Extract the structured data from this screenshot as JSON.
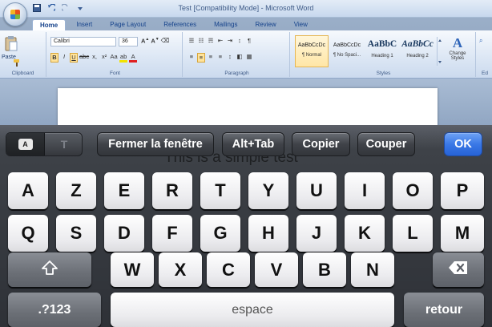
{
  "word": {
    "window_title": "Test [Compatibility Mode] - Microsoft Word",
    "qat_icons": [
      "save-icon",
      "undo-icon",
      "redo-icon",
      "customize-icon"
    ],
    "tabs": [
      "Home",
      "Insert",
      "Page Layout",
      "References",
      "Mailings",
      "Review",
      "View"
    ],
    "groups": {
      "clipboard": {
        "label": "Clipboard",
        "paste": "Paste"
      },
      "font": {
        "label": "Font",
        "name": "Calibri",
        "size": "36"
      },
      "paragraph": {
        "label": "Paragraph"
      },
      "styles": {
        "label": "Styles",
        "items": [
          {
            "sample": "AaBbCcDc",
            "name": "¶ Normal"
          },
          {
            "sample": "AaBbCcDc",
            "name": "¶ No Spaci..."
          },
          {
            "sample": "AaBbC",
            "name": "Heading 1"
          },
          {
            "sample": "AaBbCc",
            "name": "Heading 2"
          }
        ],
        "change_styles": "Change Styles"
      },
      "editing": {
        "label": "Ed"
      }
    },
    "document_text": "This is a simple test"
  },
  "keyboard": {
    "toolbar": {
      "mode_a": "A",
      "mode_t": "T",
      "close_window": "Fermer la fenêtre",
      "alt_tab": "Alt+Tab",
      "copy": "Copier",
      "cut": "Couper",
      "ok": "OK"
    },
    "rows": {
      "row1": [
        "A",
        "Z",
        "E",
        "R",
        "T",
        "Y",
        "U",
        "I",
        "O",
        "P"
      ],
      "row2": [
        "Q",
        "S",
        "D",
        "F",
        "G",
        "H",
        "J",
        "K",
        "L",
        "M"
      ],
      "row3": [
        "W",
        "X",
        "C",
        "V",
        "B",
        "N"
      ]
    },
    "shift_icon": "shift-icon",
    "backspace_icon": "backspace-icon",
    "numbers": ".?123",
    "space": "espace",
    "return": "retour"
  }
}
